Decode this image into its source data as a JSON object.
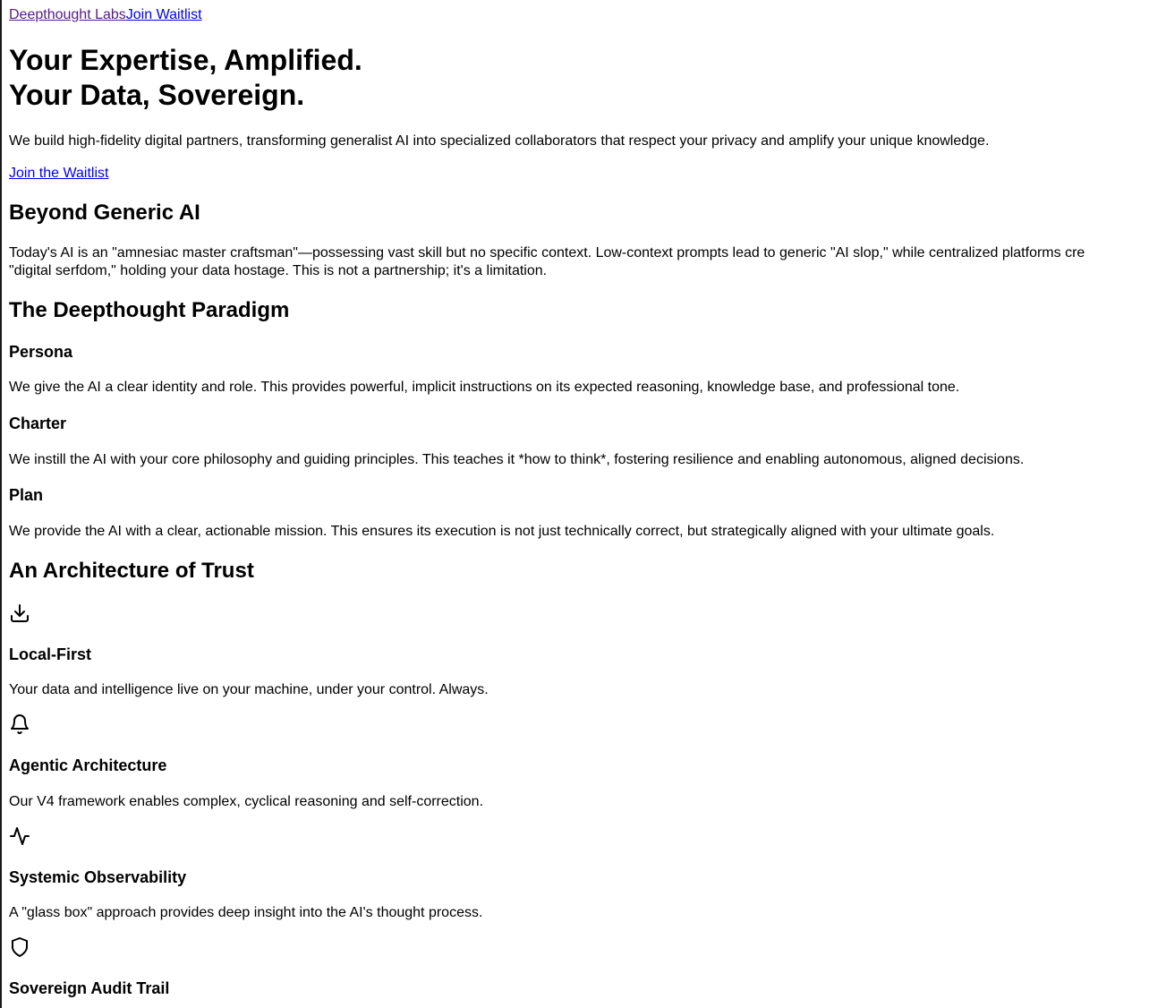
{
  "nav": {
    "brand": "Deepthought Labs",
    "join_link": "Join Waitlist"
  },
  "hero": {
    "title_line1": "Your Expertise, Amplified.",
    "title_line2": "Your Data, Sovereign.",
    "subtitle": "We build high-fidelity digital partners, transforming generalist AI into specialized collaborators that respect your privacy and amplify your unique knowledge.",
    "cta": "Join the Waitlist"
  },
  "beyond": {
    "heading": "Beyond Generic AI",
    "line1": "Today's AI is an \"amnesiac master craftsman\"—possessing vast skill but no specific context. Low-context prompts lead to generic \"AI slop,\" while centralized platforms cre",
    "line2": "\"digital serfdom,\" holding your data hostage. This is not a partnership; it's a limitation."
  },
  "paradigm": {
    "heading": "The Deepthought Paradigm",
    "items": [
      {
        "title": "Persona",
        "text": "We give the AI a clear identity and role. This provides powerful, implicit instructions on its expected reasoning, knowledge base, and professional tone."
      },
      {
        "title": "Charter",
        "text": "We instill the AI with your core philosophy and guiding principles. This teaches it *how to think*, fostering resilience and enabling autonomous, aligned decisions."
      },
      {
        "title": "Plan",
        "text": "We provide the AI with a clear, actionable mission. This ensures its execution is not just technically correct, but strategically aligned with your ultimate goals."
      }
    ]
  },
  "trust": {
    "heading": "An Architecture of Trust",
    "items": [
      {
        "icon": "download-icon",
        "title": "Local-First",
        "text": "Your data and intelligence live on your machine, under your control. Always."
      },
      {
        "icon": "bell-icon",
        "title": "Agentic Architecture",
        "text": "Our V4 framework enables complex, cyclical reasoning and self-correction."
      },
      {
        "icon": "activity-icon",
        "title": "Systemic Observability",
        "text": "A \"glass box\" approach provides deep insight into the AI's thought process."
      },
      {
        "icon": "shield-icon",
        "title": "Sovereign Audit Trail",
        "text": ""
      }
    ]
  }
}
